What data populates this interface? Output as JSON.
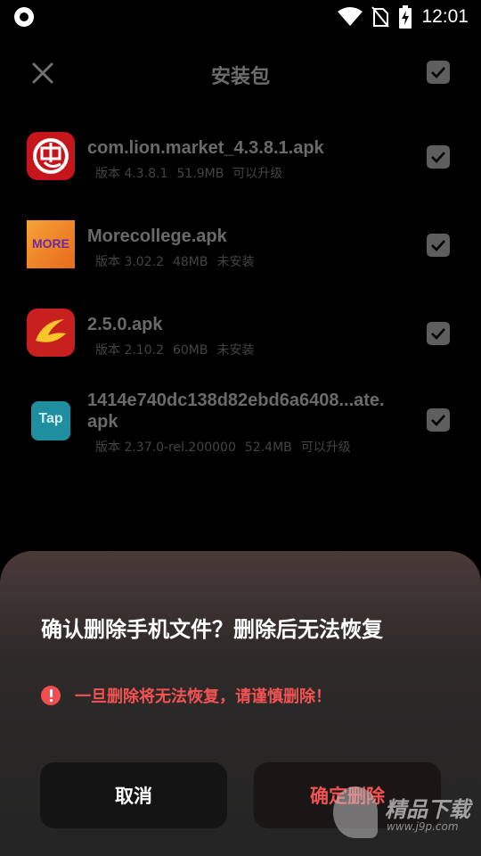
{
  "status_bar": {
    "time": "12:01",
    "icons": [
      "app-notification-icon",
      "wifi-icon",
      "no-sim-icon",
      "battery-charging-icon"
    ]
  },
  "header": {
    "title": "安装包",
    "close_icon": "close-icon",
    "select_all_checked": true
  },
  "files": [
    {
      "name": "com.lion.market_4.3.8.1.apk",
      "version": "版本 4.3.8.1",
      "size": "51.9MB",
      "status": "可以升级",
      "checked": true,
      "icon": "chong-app-icon"
    },
    {
      "name": "Morecollege.apk",
      "version": "版本 3.02.2",
      "size": "48MB",
      "status": "未安装",
      "checked": true,
      "icon": "more-app-icon"
    },
    {
      "name": "2.5.0.apk",
      "version": "版本 2.10.2",
      "size": "60MB",
      "status": "未安装",
      "checked": true,
      "icon": "swoosh-app-icon"
    },
    {
      "name_line1": "1414e740dc138d82ebd6a6408...ate.",
      "name_line2": "apk",
      "version": "版本 2.37.0-rel.200000",
      "size": "52.4MB",
      "status": "可以升级",
      "checked": true,
      "icon": "tap-app-icon",
      "icon_label": "Tap"
    }
  ],
  "more_icon_label": "MORE",
  "dialog": {
    "title": "确认删除手机文件？删除后无法恢复",
    "warning": "一旦删除将无法恢复，请谨慎删除！",
    "cancel_label": "取消",
    "confirm_label": "确定删除"
  },
  "watermark": {
    "text": "精品下载",
    "sub": "www.j9p.com"
  },
  "colors": {
    "danger": "#f45252",
    "sheet_bg": "#2d2a29",
    "button_bg": "#141414"
  }
}
